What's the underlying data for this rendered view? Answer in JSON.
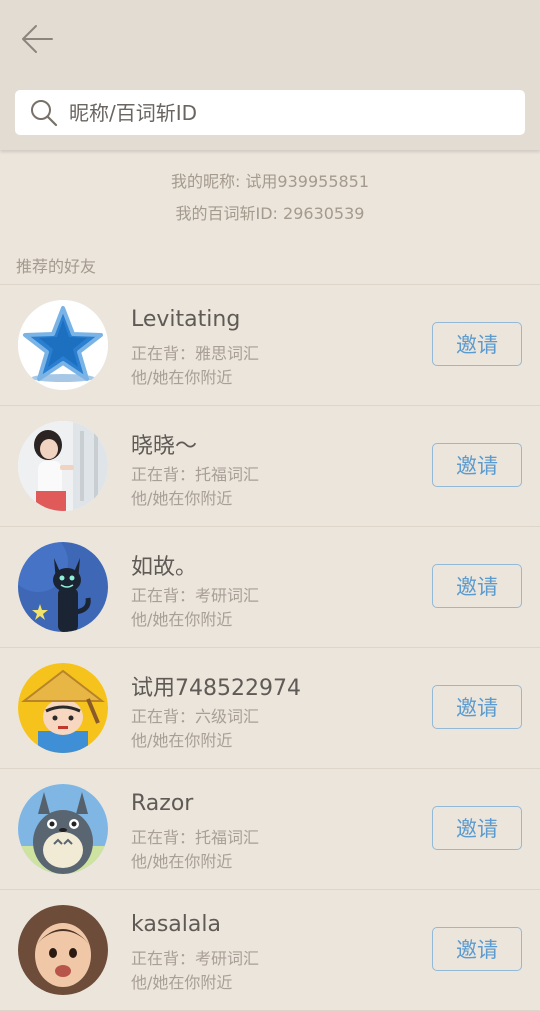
{
  "header": {
    "title": "",
    "back_icon": "arrow-left-icon"
  },
  "search": {
    "placeholder": "昵称/百词斩ID",
    "icon": "search-icon"
  },
  "my_info": {
    "nickname_line": "我的昵称: 试用939955851",
    "id_line": "我的百词斩ID: 29630539"
  },
  "section_title": "推荐的好友",
  "colors": {
    "background": "#ebe5dc",
    "header": "#e3dcd3",
    "accent_blue": "#5b9bd0",
    "muted_text": "#a49a8d"
  },
  "friends": [
    {
      "name": "Levitating",
      "studying": "正在背：雅思词汇",
      "distance": "他/她在你附近",
      "invite_label": "邀请",
      "avatar": "blue-star-avatar"
    },
    {
      "name": "晓晓～",
      "studying": "正在背：托福词汇",
      "distance": "他/她在你附近",
      "invite_label": "邀请",
      "avatar": "girl-photo-avatar"
    },
    {
      "name": "如故。",
      "studying": "正在背：考研词汇",
      "distance": "他/她在你附近",
      "invite_label": "邀请",
      "avatar": "black-cat-avatar"
    },
    {
      "name": "试用748522974",
      "studying": "正在背：六级词汇",
      "distance": "他/她在你附近",
      "invite_label": "邀请",
      "avatar": "straw-hat-cartoon-avatar"
    },
    {
      "name": "Razor",
      "studying": "正在背：托福词汇",
      "distance": "他/她在你附近",
      "invite_label": "邀请",
      "avatar": "totoro-avatar"
    },
    {
      "name": "kasalala",
      "studying": "正在背：考研词汇",
      "distance": "他/她在你附近",
      "invite_label": "邀请",
      "avatar": "child-photo-avatar"
    }
  ]
}
